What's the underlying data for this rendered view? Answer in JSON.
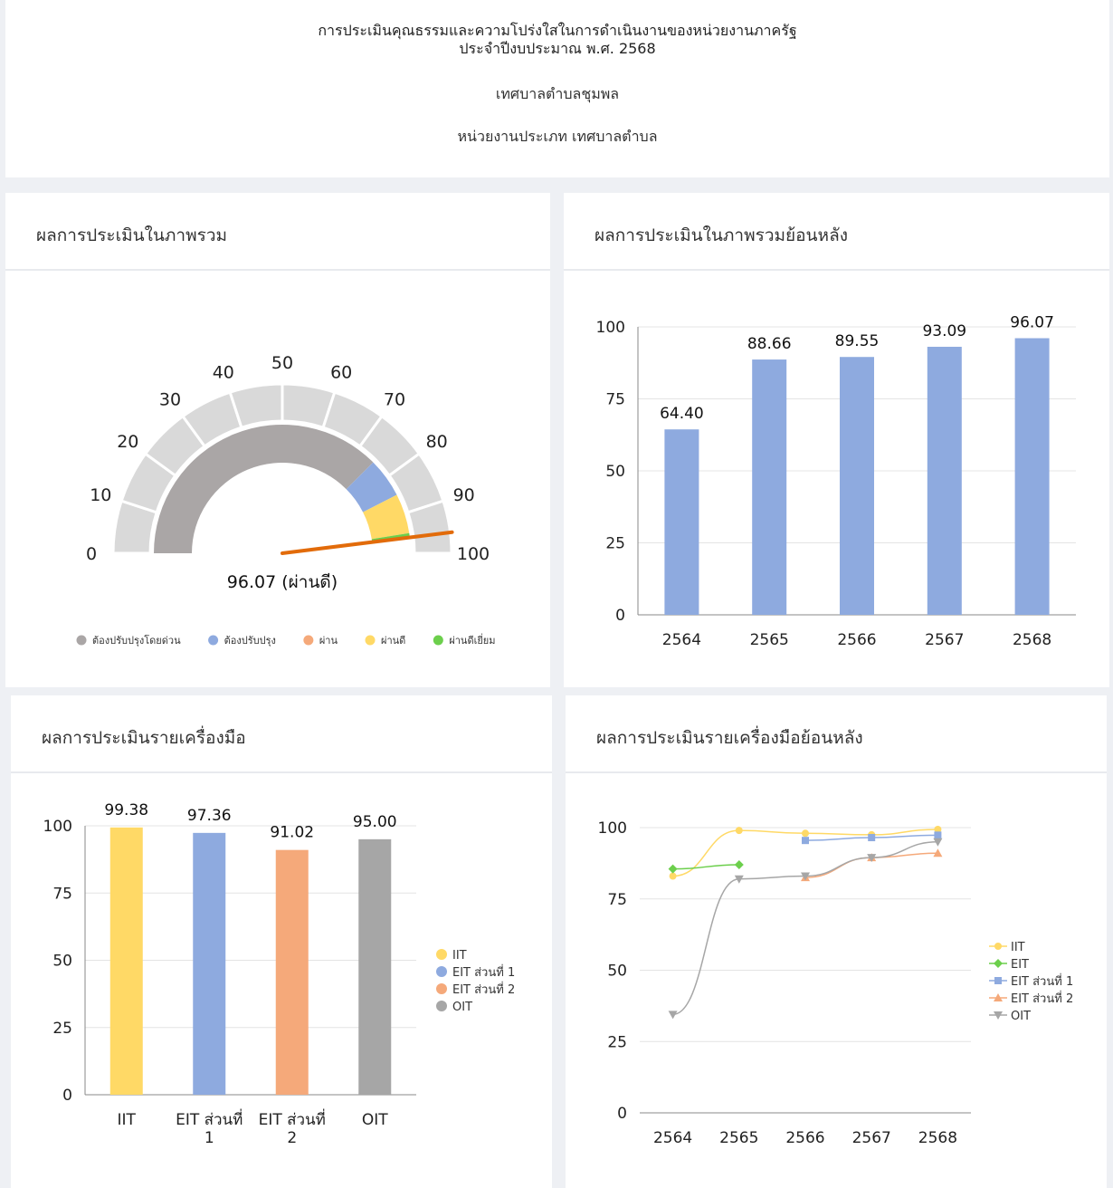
{
  "header": {
    "line1": "การประเมินคุณธรรมและความโปร่งใสในการดำเนินงานของหน่วยงานภาครัฐ",
    "line2": "ประจำปีงบประมาณ พ.ศ. 2568",
    "org": "เทศบาลตำบลชุมพล",
    "org_type": "หน่วยงานประเภท เทศบาลตำบล"
  },
  "panels": {
    "overall": "ผลการประเมินในภาพรวม",
    "overall_history": "ผลการประเมินในภาพรวมย้อนหลัง",
    "by_tool": "ผลการประเมินรายเครื่องมือ",
    "by_tool_history": "ผลการประเมินรายเครื่องมือย้อนหลัง"
  },
  "colors": {
    "gray": "#aaa6a6",
    "blue": "#8eaadf",
    "orange": "#f5a97a",
    "yellow": "#ffd966",
    "green": "#6ccf4c",
    "bar": "#8eaadf",
    "needle": "#e26b0a",
    "oit": "#a6a6a6"
  },
  "chart_data": [
    {
      "type": "gauge",
      "value": 96.07,
      "value_label": "96.07 (ผ่านดี)",
      "range": [
        0,
        100
      ],
      "ticks": [
        "0",
        "10",
        "20",
        "30",
        "40",
        "50",
        "60",
        "70",
        "80",
        "90",
        "100"
      ],
      "bands": [
        {
          "from": 0,
          "to": 75,
          "color": "#aaa6a6"
        },
        {
          "from": 75,
          "to": 85,
          "color": "#8eaadf"
        },
        {
          "from": 85,
          "to": 95,
          "color": "#ffd966"
        },
        {
          "from": 95,
          "to": 100,
          "color": "#6ccf4c"
        }
      ],
      "legend": [
        {
          "label": "ต้องปรับปรุงโดยด่วน",
          "color": "#aaa6a6"
        },
        {
          "label": "ต้องปรับปรุง",
          "color": "#8eaadf"
        },
        {
          "label": "ผ่าน",
          "color": "#f5a97a"
        },
        {
          "label": "ผ่านดี",
          "color": "#ffd966"
        },
        {
          "label": "ผ่านดีเยี่ยม",
          "color": "#6ccf4c"
        }
      ]
    },
    {
      "type": "bar",
      "categories": [
        "2564",
        "2565",
        "2566",
        "2567",
        "2568"
      ],
      "values": [
        64.4,
        88.66,
        89.55,
        93.09,
        96.07
      ],
      "value_labels": [
        "64.40",
        "88.66",
        "89.55",
        "93.09",
        "96.07"
      ],
      "ylim": [
        0,
        100
      ],
      "yticks": [
        "0",
        "25",
        "50",
        "75",
        "100"
      ],
      "grid": true
    },
    {
      "type": "bar",
      "categories": [
        [
          "IIT"
        ],
        [
          "EIT ส่วนที่",
          "1"
        ],
        [
          "EIT ส่วนที่",
          "2"
        ],
        [
          "OIT"
        ]
      ],
      "values": [
        99.38,
        97.36,
        91.02,
        95.0
      ],
      "value_labels": [
        "99.38",
        "97.36",
        "91.02",
        "95.00"
      ],
      "colors": [
        "#ffd966",
        "#8eaadf",
        "#f5a97a",
        "#a6a6a6"
      ],
      "ylim": [
        0,
        100
      ],
      "yticks": [
        "0",
        "25",
        "50",
        "75",
        "100"
      ],
      "legend": [
        {
          "label": "IIT",
          "color": "#ffd966"
        },
        {
          "label": "EIT ส่วนที่ 1",
          "color": "#8eaadf"
        },
        {
          "label": "EIT ส่วนที่ 2",
          "color": "#f5a97a"
        },
        {
          "label": "OIT",
          "color": "#a6a6a6"
        }
      ],
      "legend_position": "right",
      "grid": true
    },
    {
      "type": "line",
      "x": [
        "2564",
        "2565",
        "2566",
        "2567",
        "2568"
      ],
      "ylim": [
        0,
        100
      ],
      "yticks": [
        "0",
        "25",
        "50",
        "75",
        "100"
      ],
      "series": [
        {
          "name": "IIT",
          "color": "#ffd966",
          "marker": "circle",
          "values": [
            83,
            99,
            98,
            97.5,
            99.38
          ]
        },
        {
          "name": "EIT",
          "color": "#6ccf4c",
          "marker": "diamond",
          "values": [
            85.5,
            87,
            null,
            null,
            null
          ]
        },
        {
          "name": "EIT ส่วนที่ 1",
          "color": "#8eaadf",
          "marker": "square",
          "values": [
            null,
            null,
            95.5,
            96.5,
            97.36
          ]
        },
        {
          "name": "EIT ส่วนที่ 2",
          "color": "#f5a97a",
          "marker": "triangle",
          "values": [
            null,
            null,
            82.5,
            89.5,
            91.02
          ]
        },
        {
          "name": "OIT",
          "color": "#a6a6a6",
          "marker": "triangle-down",
          "values": [
            34.5,
            82,
            83,
            89.5,
            95.0
          ]
        }
      ],
      "legend_position": "right",
      "grid": true
    }
  ]
}
